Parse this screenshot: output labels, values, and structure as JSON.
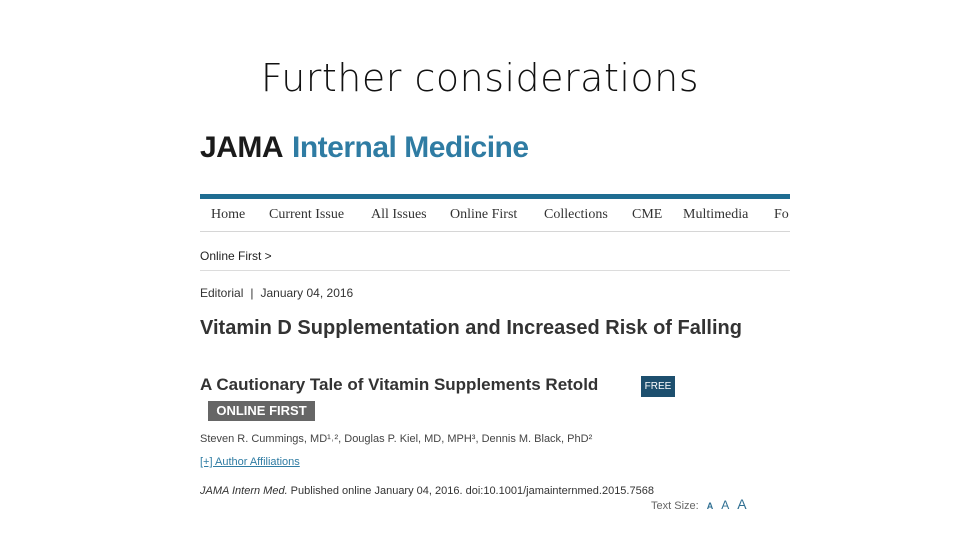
{
  "slide": {
    "title": "Further considerations"
  },
  "brand": {
    "part1": "JAMA",
    "part2": "Internal Medicine"
  },
  "nav": {
    "items": [
      "Home",
      "Current Issue",
      "All Issues",
      "Online First",
      "Collections",
      "CME",
      "Multimedia",
      "Fo"
    ]
  },
  "breadcrumb": "Online First >",
  "meta": {
    "type": "Editorial",
    "separator": "|",
    "date": "January 04, 2016"
  },
  "article": {
    "title": "Vitamin D Supplementation and Increased Risk of Falling",
    "subtitle": "A Cautionary Tale of Vitamin Supplements Retold",
    "free_badge": "FREE",
    "online_first_badge": "ONLINE FIRST",
    "authors": "Steven R. Cummings, MD¹˒², Douglas P. Kiel, MD, MPH³, Dennis M. Black, PhD²",
    "affiliations_link": "[+] Author Affiliations",
    "citation_journal": "JAMA Intern Med.",
    "citation_rest": " Published online January 04, 2016. doi:10.1001/jamainternmed.2015.7568"
  },
  "text_size": {
    "label": "Text Size:",
    "options": [
      "A",
      "A",
      "A"
    ]
  },
  "colors": {
    "brand_blue": "#2f7ca3",
    "nav_bar": "#1f6d92",
    "free_badge": "#1d4f6e",
    "online_first_badge": "#666666"
  }
}
